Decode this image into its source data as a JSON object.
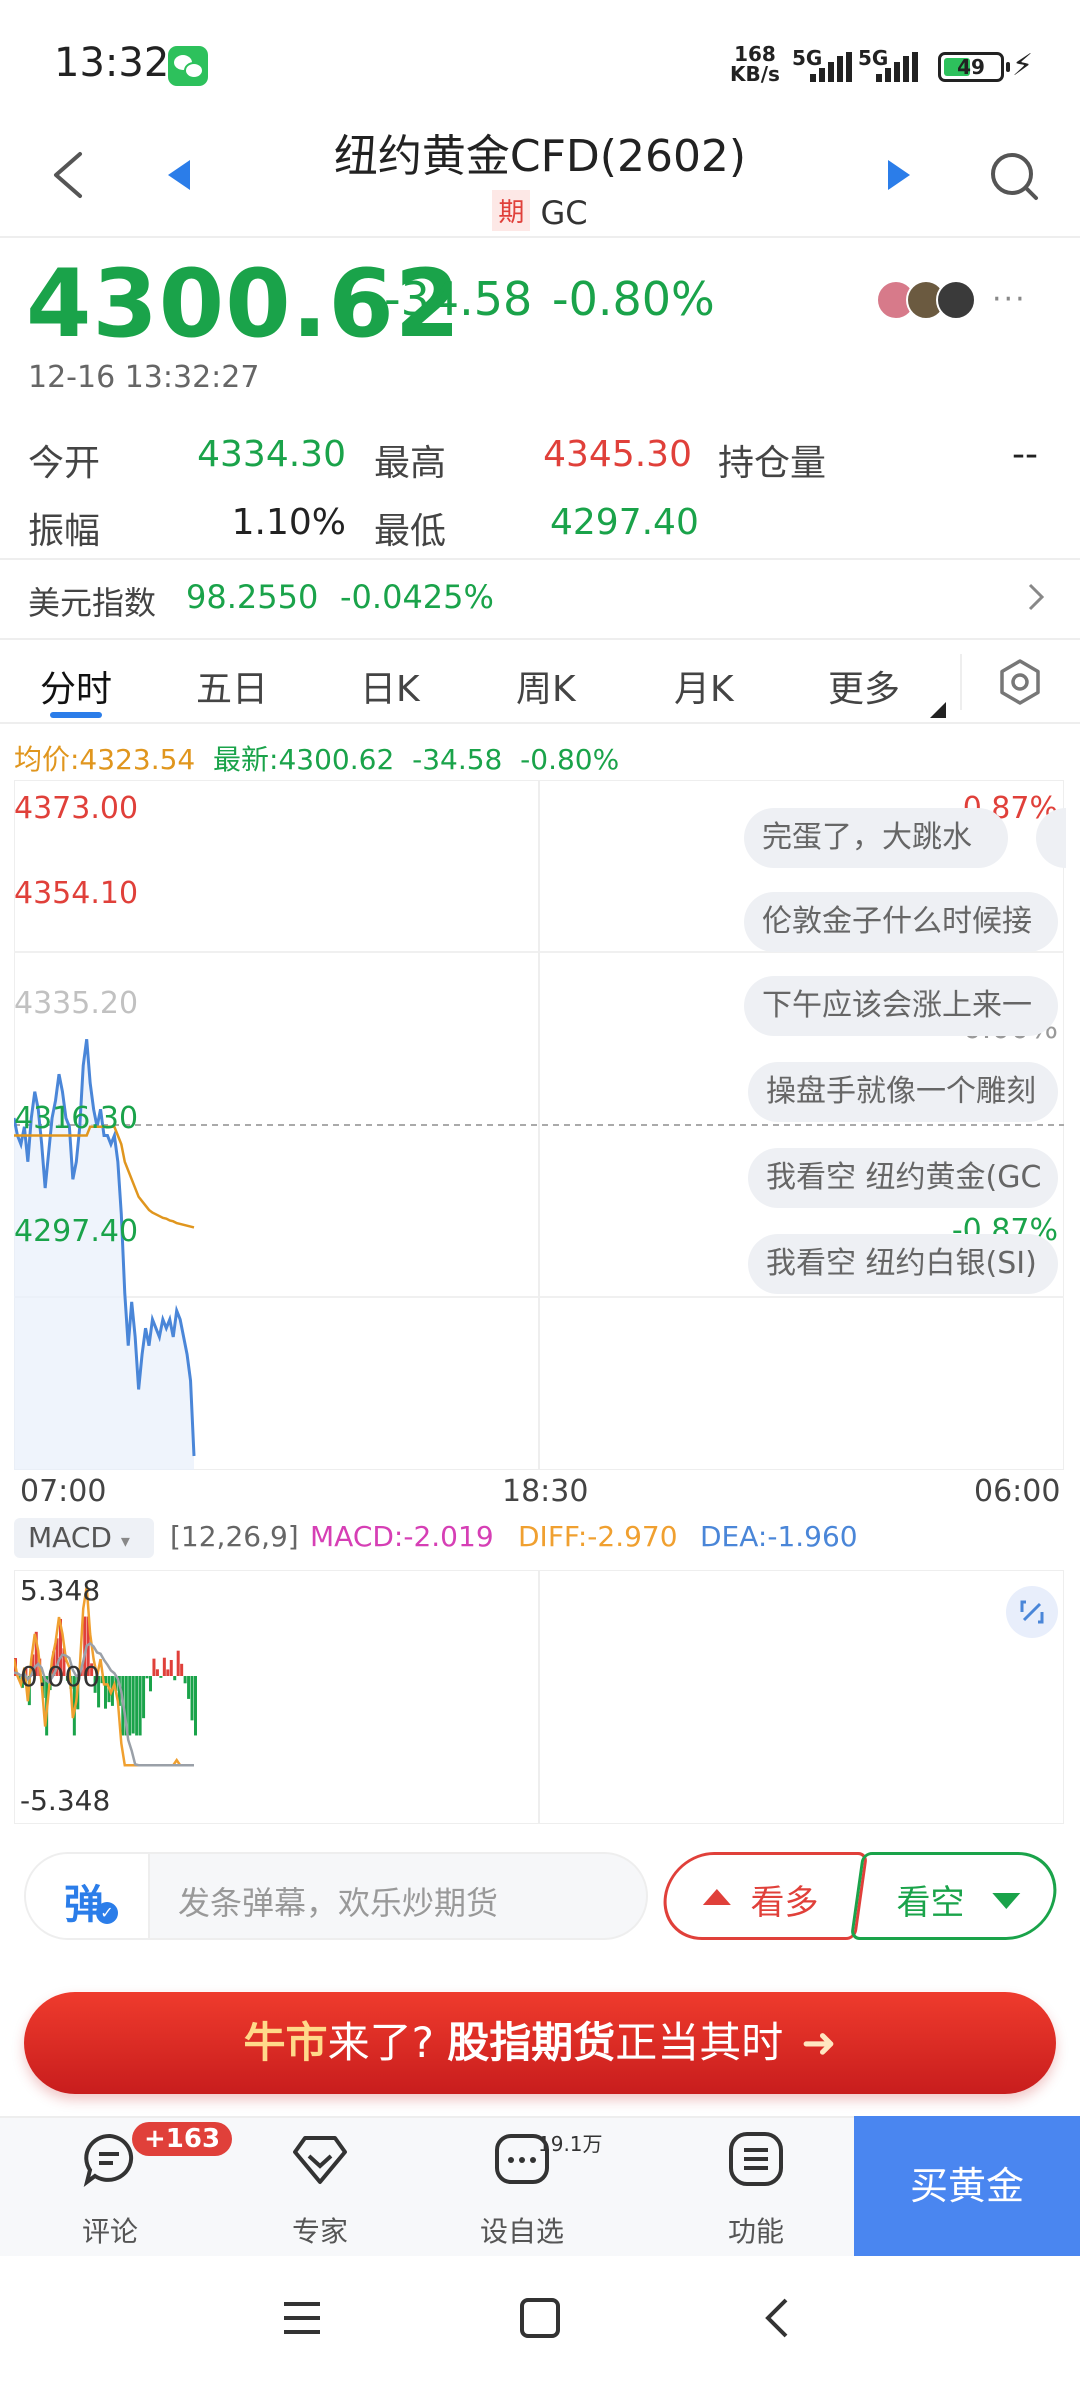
{
  "status_bar": {
    "time": "13:32",
    "net_speed_value": "168",
    "net_speed_unit": "KB/s",
    "signal1_label": "5G",
    "signal2_label": "5G",
    "battery_level": "49"
  },
  "header": {
    "title": "纽约黄金CFD(2602)",
    "tag": "期",
    "code": "GC"
  },
  "quote": {
    "price": "4300.62",
    "change": "-34.58",
    "change_pct": "-0.80%",
    "timestamp": "12-16 13:32:27",
    "more": "···"
  },
  "stats": {
    "open_label": "今开",
    "open_value": "4334.30",
    "high_label": "最高",
    "high_value": "4345.30",
    "oi_label": "持仓量",
    "oi_value": "--",
    "amp_label": "振幅",
    "amp_value": "1.10%",
    "low_label": "最低",
    "low_value": "4297.40"
  },
  "index": {
    "label": "美元指数",
    "value": "98.2550",
    "pct": "-0.0425%"
  },
  "tabs": [
    "分时",
    "五日",
    "日K",
    "周K",
    "月K",
    "更多"
  ],
  "info_line": {
    "avg": "均价:4323.54",
    "latest": "最新:4300.62",
    "change": "-34.58",
    "pct": "-0.80%"
  },
  "chart_data": {
    "type": "line",
    "x_ticks": [
      "07:00",
      "18:30",
      "06:00"
    ],
    "y_ticks_left": [
      "4373.00",
      "4354.10",
      "4335.20",
      "4316.30",
      "4297.40"
    ],
    "y_ticks_right": [
      "0.87%",
      "0.00%",
      "-0.87%"
    ],
    "ylim": [
      4297.4,
      4373.0
    ],
    "prev_close": 4335.2,
    "series": [
      {
        "values": [
          4336,
          4334,
          4333,
          4335,
          4331,
          4336,
          4339,
          4337,
          4333,
          4328,
          4332,
          4336,
          4338,
          4341,
          4339,
          4336,
          4335,
          4329,
          4331,
          4335,
          4342,
          4345,
          4340,
          4337,
          4335,
          4337,
          4334,
          4334,
          4333,
          4334,
          4331,
          4325,
          4316,
          4310,
          4315,
          4311,
          4305,
          4309,
          4312,
          4310,
          4313,
          4312,
          4311,
          4313,
          4312,
          4313,
          4311,
          4314,
          4313,
          4311,
          4309,
          4306,
          4297.4
        ]
      },
      {
        "values": [
          4334,
          4334,
          4334,
          4334,
          4334,
          4334,
          4334,
          4334,
          4334,
          4334,
          4334,
          4334,
          4334,
          4334,
          4334,
          4334,
          4334,
          4334,
          4334,
          4334,
          4334,
          4334,
          4335,
          4335,
          4335,
          4335,
          4335,
          4335,
          4335,
          4335,
          4334,
          4333,
          4331,
          4330,
          4329,
          4328,
          4327,
          4326.5,
          4326,
          4325.5,
          4325.2,
          4325,
          4324.8,
          4324.6,
          4324.5,
          4324.3,
          4324.2,
          4324,
          4323.9,
          4323.8,
          4323.7,
          4323.6,
          4323.5
        ]
      }
    ]
  },
  "danmaku": [
    "完蛋了，大跳水",
    "伦敦金子什么时候接",
    "下午应该会涨上来一",
    "操盘手就像一个雕刻",
    "我看空 纽约黄金(GC",
    "我看空 纽约白银(SI)"
  ],
  "macd": {
    "selector": "MACD",
    "params": "[12,26,9]",
    "macd": "MACD:-2.019",
    "diff": "DIFF:-2.970",
    "dea": "DEA:-1.960",
    "y_ticks": [
      "5.348",
      "0.000",
      "-5.348"
    ],
    "ylim": [
      -5.348,
      5.348
    ]
  },
  "comment_bar": {
    "danmu_char": "弹",
    "placeholder": "发条弹幕，欢乐炒期货",
    "bull_label": "看多",
    "bear_label": "看空"
  },
  "banner": {
    "part1": "牛市",
    "part2": "来了?",
    "part3": "股指期货",
    "part4": "正当其时"
  },
  "bottom_nav": {
    "comment_label": "评论",
    "comment_badge": "+163",
    "expert_label": "专家",
    "watch_label": "设自选",
    "watch_count": "19.1万",
    "func_label": "功能",
    "buy_label": "买黄金"
  },
  "colors": {
    "up": "#e0403a",
    "down": "#1aa34a",
    "accent": "#2b7de9",
    "price_line": "#4a86d8",
    "avg_line": "#e0961e"
  }
}
